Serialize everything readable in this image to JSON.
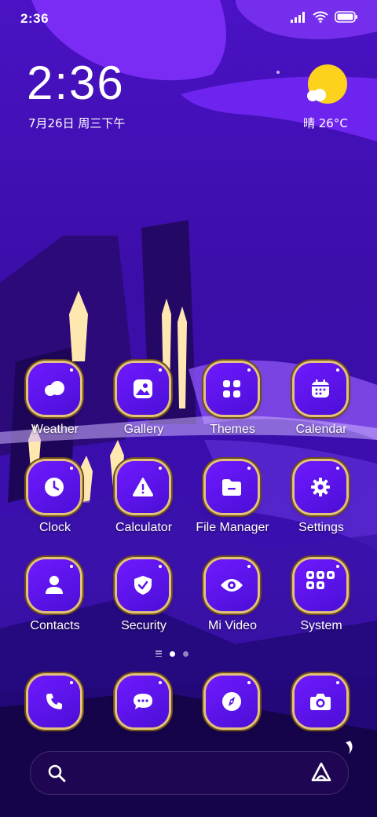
{
  "status_bar": {
    "time": "2:36"
  },
  "lockclock": {
    "time": "2:36",
    "date": "7月26日 周三下午"
  },
  "weather": {
    "condition_temp": "晴 26°C"
  },
  "apps": [
    {
      "label": "Weather",
      "icon": "weather-icon"
    },
    {
      "label": "Gallery",
      "icon": "gallery-icon"
    },
    {
      "label": "Themes",
      "icon": "themes-icon"
    },
    {
      "label": "Calendar",
      "icon": "calendar-icon"
    },
    {
      "label": "Clock",
      "icon": "clock-icon"
    },
    {
      "label": "Calculator",
      "icon": "calculator-icon"
    },
    {
      "label": "File Manager",
      "icon": "file-manager-icon"
    },
    {
      "label": "Settings",
      "icon": "settings-icon"
    },
    {
      "label": "Contacts",
      "icon": "contacts-icon"
    },
    {
      "label": "Security",
      "icon": "security-icon"
    },
    {
      "label": "Mi Video",
      "icon": "mi-video-icon"
    },
    {
      "label": "System",
      "icon": "system-folder-icon"
    }
  ],
  "dock": [
    {
      "icon": "phone-icon"
    },
    {
      "icon": "messages-icon"
    },
    {
      "icon": "browser-icon"
    },
    {
      "icon": "camera-icon"
    }
  ],
  "page_indicator": {
    "pages": 2,
    "current": 1
  },
  "colors": {
    "icon_bg": "#5a14ee",
    "icon_border": "#e3c27e",
    "wallpaper": "#3a0da8",
    "sun": "#fcd21c"
  }
}
